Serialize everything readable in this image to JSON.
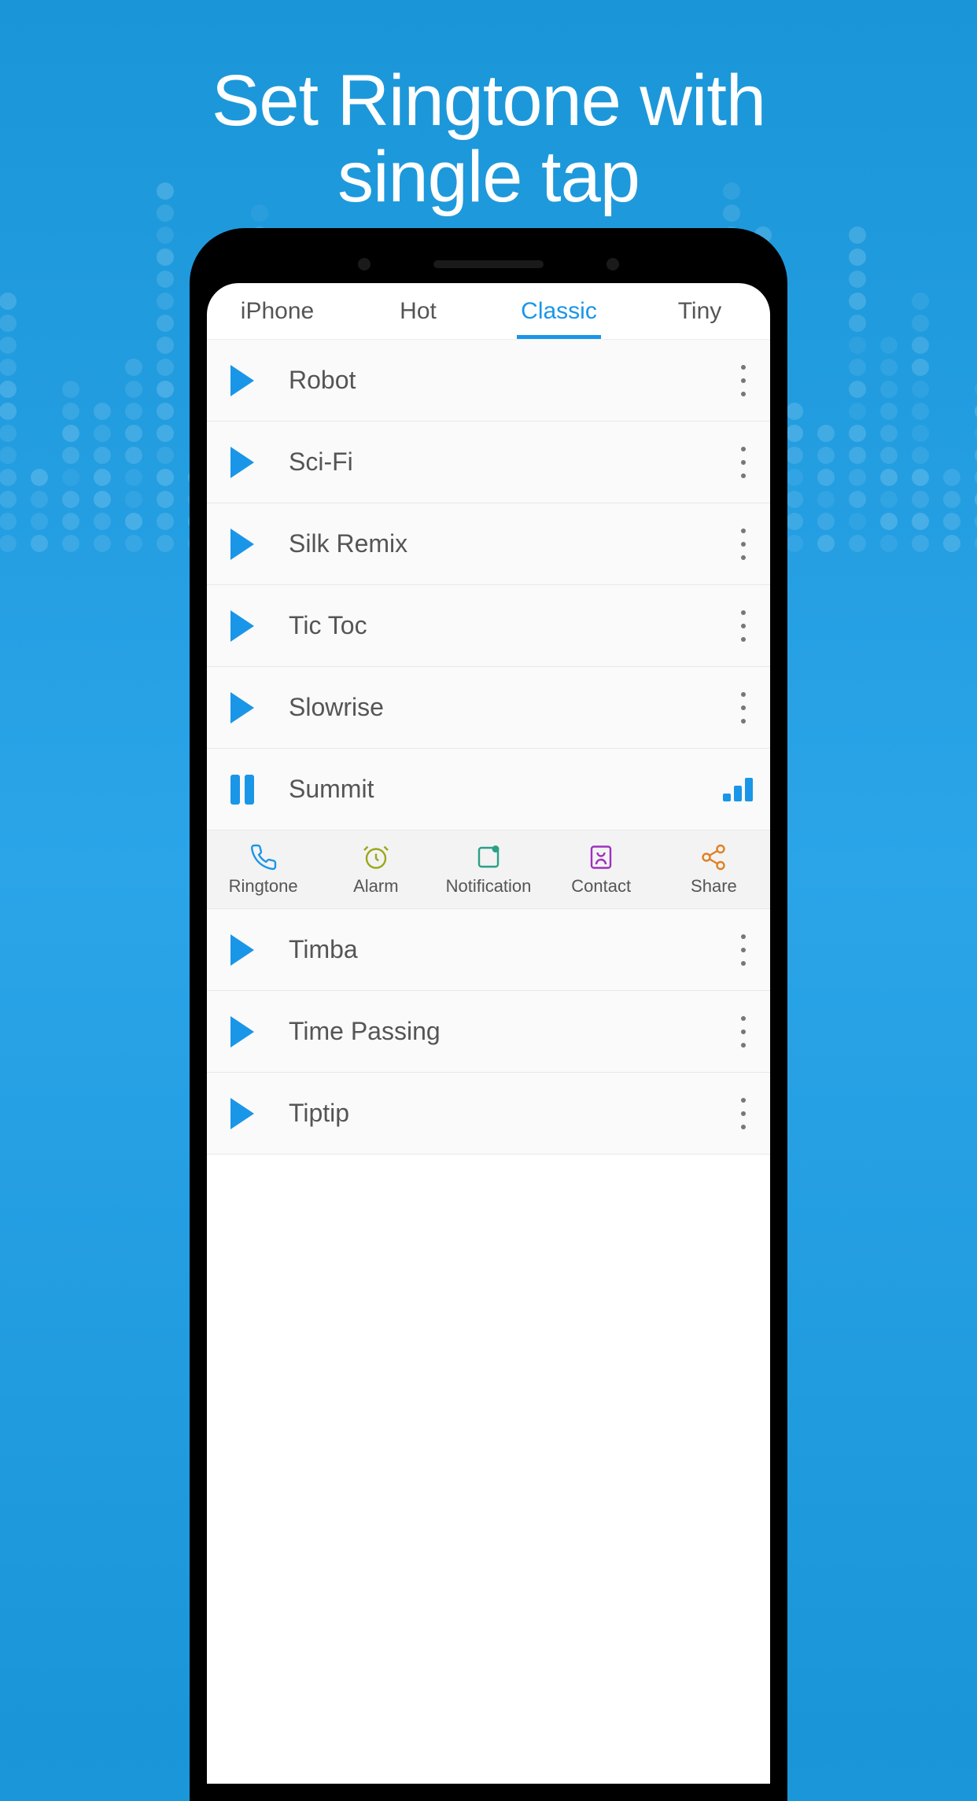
{
  "headline": {
    "line1": "Set Ringtone with",
    "line2": "single tap"
  },
  "tabs": [
    {
      "label": "iPhone",
      "active": false
    },
    {
      "label": "Hot",
      "active": false
    },
    {
      "label": "Classic",
      "active": true
    },
    {
      "label": "Tiny",
      "active": false
    }
  ],
  "ringtones": [
    {
      "title": "Robot",
      "state": "idle"
    },
    {
      "title": "Sci-Fi",
      "state": "idle"
    },
    {
      "title": "Silk Remix",
      "state": "idle"
    },
    {
      "title": "Tic Toc",
      "state": "idle"
    },
    {
      "title": "Slowrise",
      "state": "idle"
    },
    {
      "title": "Summit",
      "state": "playing"
    },
    {
      "title": "Timba",
      "state": "idle"
    },
    {
      "title": "Time Passing",
      "state": "idle"
    },
    {
      "title": "Tiptip",
      "state": "idle"
    }
  ],
  "actions": [
    {
      "label": "Ringtone",
      "icon": "phone",
      "color": "#1a96e8"
    },
    {
      "label": "Alarm",
      "icon": "clock",
      "color": "#9aa81a"
    },
    {
      "label": "Notification",
      "icon": "note",
      "color": "#2aa088"
    },
    {
      "label": "Contact",
      "icon": "contact",
      "color": "#a030c0"
    },
    {
      "label": "Share",
      "icon": "share",
      "color": "#e08020"
    }
  ]
}
